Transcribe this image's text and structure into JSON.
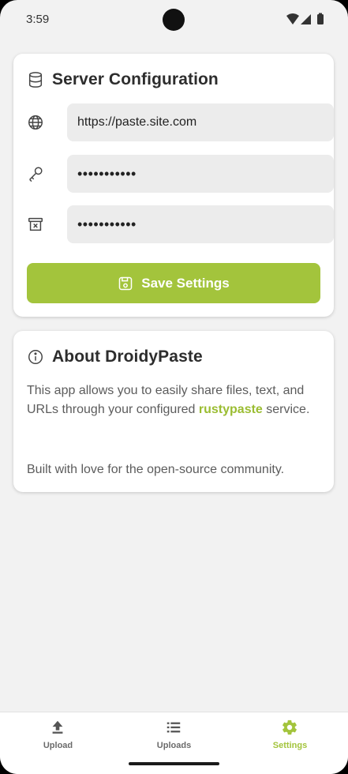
{
  "status_bar": {
    "time": "3:59"
  },
  "server_config": {
    "title": "Server Configuration",
    "url_value": "https://paste.site.com",
    "auth_token_value": "•••••••••••",
    "delete_token_value": "•••••••••••",
    "save_label": "Save Settings"
  },
  "about": {
    "title": "About DroidyPaste",
    "text_before": "This app allows you to easily share files, text, and URLs through your configured ",
    "link_text": "rustypaste",
    "text_after": " service.",
    "footer": "Built with love for the open-source community."
  },
  "nav": {
    "items": [
      {
        "label": "Upload",
        "icon": "upload-icon"
      },
      {
        "label": "Uploads",
        "icon": "list-icon"
      },
      {
        "label": "Settings",
        "icon": "gear-icon"
      }
    ],
    "active": "Settings"
  },
  "colors": {
    "accent": "#a3c43c",
    "background": "#f2f2f2",
    "card": "#ffffff",
    "input": "#ececec"
  }
}
